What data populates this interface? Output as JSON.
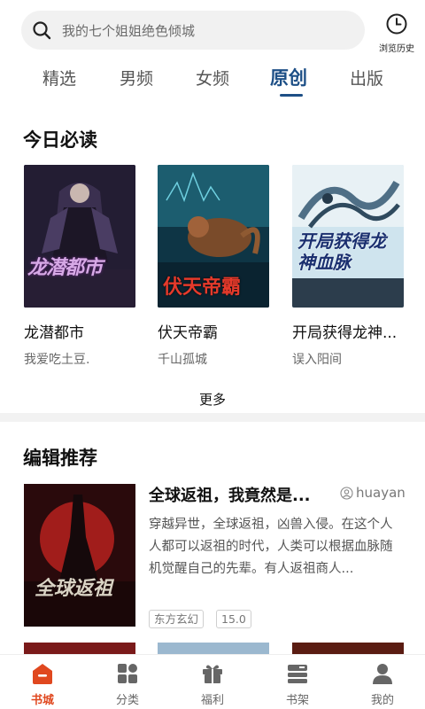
{
  "search": {
    "placeholder": "我的七个姐姐绝色倾城"
  },
  "history": {
    "label": "浏览历史"
  },
  "tabs": [
    {
      "label": "精选"
    },
    {
      "label": "男频"
    },
    {
      "label": "女频"
    },
    {
      "label": "原创"
    },
    {
      "label": "出版"
    }
  ],
  "today": {
    "title": "今日必读",
    "more_label": "更多",
    "books": [
      {
        "title": "龙潜都市",
        "author": "我爱吃土豆.",
        "cover_text": "龙潜都市"
      },
      {
        "title": "伏天帝霸",
        "author": "千山孤城",
        "cover_text": "伏天帝霸"
      },
      {
        "title": "开局获得龙神...",
        "author": "误入阳间",
        "cover_text": "开局获得龙神血脉"
      }
    ]
  },
  "editor": {
    "title": "编辑推荐",
    "book": {
      "title": "全球返祖，我竟然是...",
      "author": "huayan",
      "description": "穿越异世，全球返祖，凶兽入侵。在这个人人都可以返祖的时代，人类可以根据血脉随机觉醒自己的先辈。有人返祖商人...",
      "tags": [
        "东方玄幻",
        "15.0"
      ],
      "cover_text": "全球返祖"
    }
  },
  "bottom_nav": [
    {
      "label": "书城",
      "icon": "home-icon"
    },
    {
      "label": "分类",
      "icon": "grid-icon"
    },
    {
      "label": "福利",
      "icon": "gift-icon"
    },
    {
      "label": "书架",
      "icon": "bookshelf-icon"
    },
    {
      "label": "我的",
      "icon": "user-icon"
    }
  ],
  "colors": {
    "accent": "#1d4f86",
    "active_nav": "#e0481f"
  }
}
